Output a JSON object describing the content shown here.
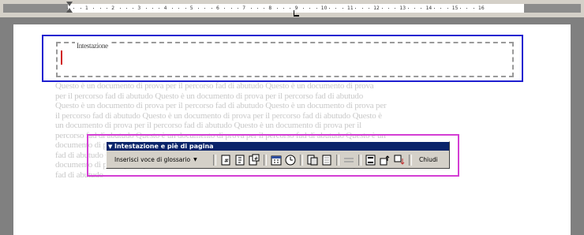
{
  "ruler": {
    "ticks": [
      "1",
      "2",
      "3",
      "4",
      "5",
      "6",
      "7",
      "8",
      "9",
      "10",
      "11",
      "12",
      "13",
      "14",
      "15",
      "16"
    ]
  },
  "header": {
    "label": "Intestazione"
  },
  "body": {
    "lines": [
      "Questo è un documento di prova per il percorso fad di abutudo Questo è un documento di prova",
      "per il percorso fad di abutudo Questo è un documento di prova per il percorso fad di abutudo",
      "Questo è un documento di prova per il percorso fad di abutudo Questo è un documento di prova per",
      "il percorso fad di abutudo Questo è un documento di prova per il percorso fad di abutudo Questo è",
      "un documento di prova per il percorso fad di abutudo Questo è un documento di prova per il",
      "percorso fad di abutudo Questo è un documento di prova per il percorso fad di abutudo Questo è un",
      "documento di prova per il percorso fad di abutudo Questo è un documento di prova per il percorso",
      "fad di abutudo Questo è un documento di prova per il percorso fad di abutudo Questo è un",
      "documento di prova per il percorso fad di abutudo Questo è un documento di prova per il percorso",
      "fad di abutudo"
    ]
  },
  "toolbar": {
    "title": "Intestazione e piè di pagina",
    "glossary_label": "Inserisci voce di glossario",
    "close_label": "Chiudi"
  },
  "colors": {
    "header_frame": "#1f1fd0",
    "toolbar_frame": "#d43ed4",
    "cursor": "#d0201c",
    "title_bar": "#0a246a"
  }
}
